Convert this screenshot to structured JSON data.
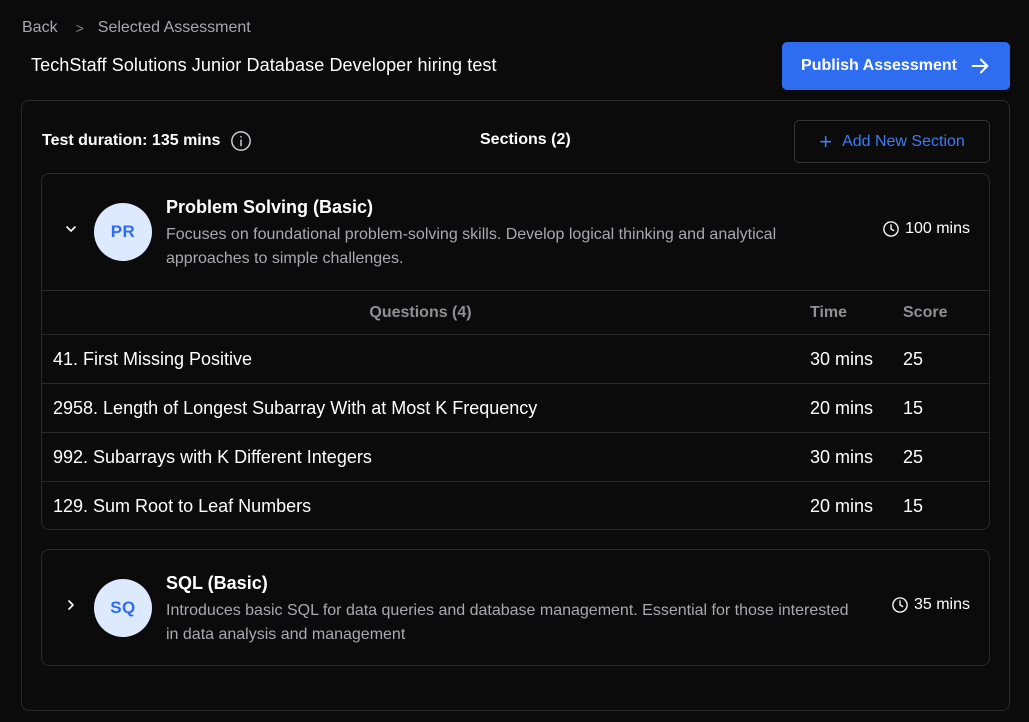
{
  "breadcrumb": {
    "back": "Back",
    "separator": ">",
    "current": "Selected Assessment"
  },
  "page_title": "TechStaff Solutions Junior Database Developer hiring test",
  "publish_button": {
    "label": "Publish Assessment",
    "icon": "arrow-right-icon"
  },
  "overview": {
    "duration": "Test duration: 135 mins",
    "info_icon": "info-icon",
    "sections_count": "Sections (2)",
    "add_section": {
      "label": "Add New Section",
      "icon": "plus-icon"
    }
  },
  "sections": [
    {
      "initials": "PR",
      "title": "Problem Solving (Basic)",
      "description": "Focuses on foundational problem-solving skills. Develop logical thinking and analytical approaches to simple challenges.",
      "time": "100 mins",
      "expanded": true,
      "table_headers": {
        "questions": "Questions (4)",
        "time": "Time",
        "score": "Score"
      },
      "questions": [
        {
          "name": "41. First Missing Positive",
          "time": "30 mins",
          "score": "25"
        },
        {
          "name": "2958. Length of Longest Subarray With at Most K Frequency",
          "time": "20 mins",
          "score": "15"
        },
        {
          "name": "992. Subarrays with K Different Integers",
          "time": "30 mins",
          "score": "25"
        },
        {
          "name": "129. Sum Root to Leaf Numbers",
          "time": "20 mins",
          "score": "15"
        }
      ]
    },
    {
      "initials": "SQ",
      "title": "SQL (Basic)",
      "description": "Introduces basic SQL for data queries and database management. Essential for those interested in data analysis and management",
      "time": "35 mins",
      "expanded": false
    }
  ],
  "colors": {
    "accent": "#2f6df0",
    "avatar_bg": "#dde9ff",
    "background": "#0b0b0c",
    "border": "#2a2a2e"
  }
}
